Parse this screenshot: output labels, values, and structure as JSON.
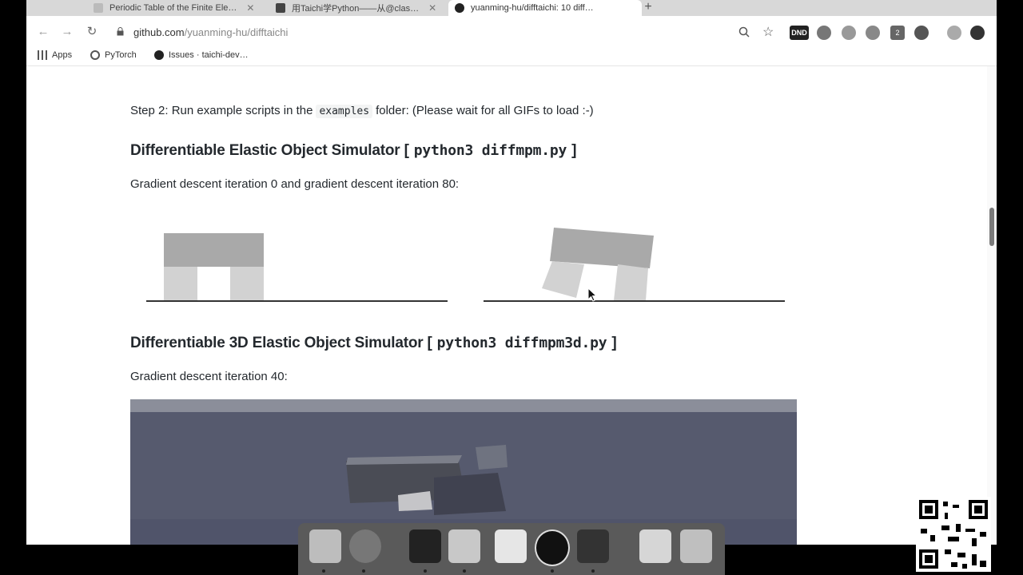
{
  "browser": {
    "tabs": [
      {
        "label": "Periodic Table of the Finite Ele…",
        "active": false
      },
      {
        "label": "用Taichi学Python——从@clas…",
        "active": false
      },
      {
        "label": "yuanming-hu/difftaichi: 10 diff…",
        "active": true
      }
    ],
    "new_tab_label": "+",
    "url_domain": "github.com",
    "url_path": "/yuanming-hu/difftaichi",
    "bookmarks": [
      "Apps",
      "PyTorch",
      "Issues · taichi-dev…"
    ],
    "extension_badges": [
      "DND",
      "2"
    ]
  },
  "page": {
    "step_text_before": "Step 2: Run example scripts in the",
    "step_code": "examples",
    "step_text_after": "folder: (Please wait for all GIFs to load :-)",
    "section1": {
      "title_prefix": "Differentiable Elastic Object Simulator",
      "bracket_open": "[",
      "command": "python3 diffmpm.py",
      "bracket_close": "]",
      "caption": "Gradient descent iteration 0 and gradient descent iteration 80:"
    },
    "section2": {
      "title_prefix": "Differentiable 3D Elastic Object Simulator",
      "bracket_open": "[",
      "command": "python3 diffmpm3d.py",
      "bracket_close": "]",
      "caption": "Gradient descent iteration 40:"
    }
  },
  "colors": {
    "sim_block": "#a9a9a9",
    "sim_leg": "#d2d2d2",
    "ground": "#333333",
    "gif3d_bg": "#5b5e73"
  }
}
